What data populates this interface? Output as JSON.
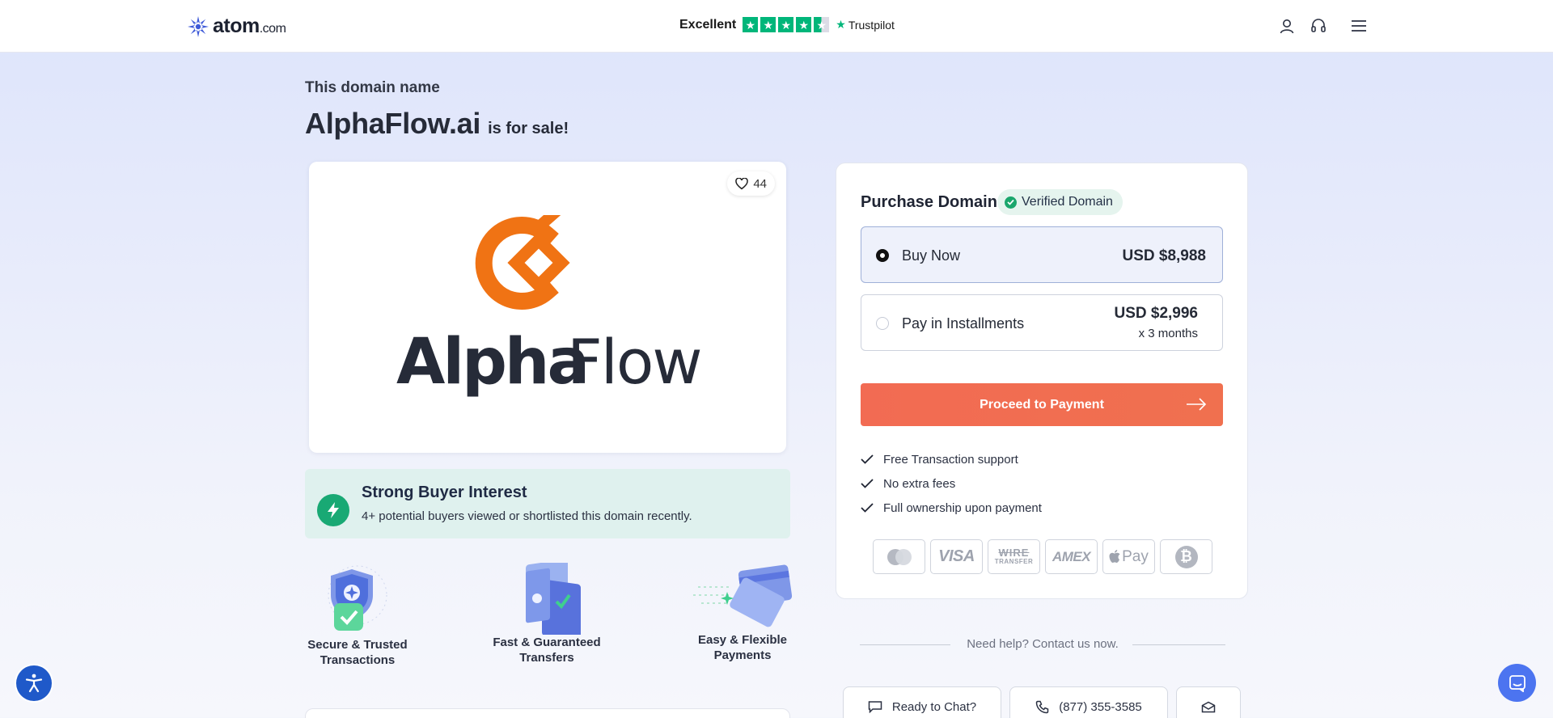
{
  "header": {
    "logo_text": "atom",
    "logo_suffix": ".com",
    "trust_label": "Excellent",
    "trust_brand": "Trustpilot",
    "icons": [
      "user-icon",
      "headset-icon",
      "menu-icon"
    ]
  },
  "page": {
    "eyebrow": "This domain name",
    "domain": "AlphaFlow.ai",
    "for_sale": "is for sale!"
  },
  "logo_card": {
    "likes": "44",
    "brand_text_bold": "Alpha",
    "brand_text_light": "Flow",
    "brand_color": "#f07314"
  },
  "interest": {
    "title": "Strong Buyer Interest",
    "description": "4+ potential buyers viewed or shortlisted this domain recently."
  },
  "features": [
    {
      "line1": "Secure & Trusted",
      "line2": "Transactions"
    },
    {
      "line1": "Fast & Guaranteed",
      "line2": "Transfers"
    },
    {
      "line1": "Easy & Flexible",
      "line2": "Payments"
    }
  ],
  "purchase": {
    "title": "Purchase Domain",
    "verified": "Verified Domain",
    "options": [
      {
        "label": "Buy Now",
        "price": "USD $8,988",
        "selected": true
      },
      {
        "label": "Pay in Installments",
        "price": "USD $2,996",
        "term": "x 3 months",
        "selected": false
      }
    ],
    "cta": "Proceed to Payment",
    "cta_color": "#f26b53",
    "benefits": [
      "Free Transaction support",
      "No extra fees",
      "Full ownership upon payment"
    ],
    "payment_methods": [
      "mastercard-icon",
      "visa-icon",
      "wire-transfer-icon",
      "amex-icon",
      "apple-pay-icon",
      "bitcoin-icon"
    ],
    "payment_labels": {
      "visa": "VISA",
      "wire_top": "WIRE",
      "wire_bottom": "TRANSFER",
      "amex": "AMEX",
      "apple_pay": "Pay",
      "bitcoin": "₿"
    }
  },
  "help": {
    "text": "Need help? Contact us now.",
    "chat": "Ready to Chat?",
    "phone": "(877) 355-3585"
  }
}
